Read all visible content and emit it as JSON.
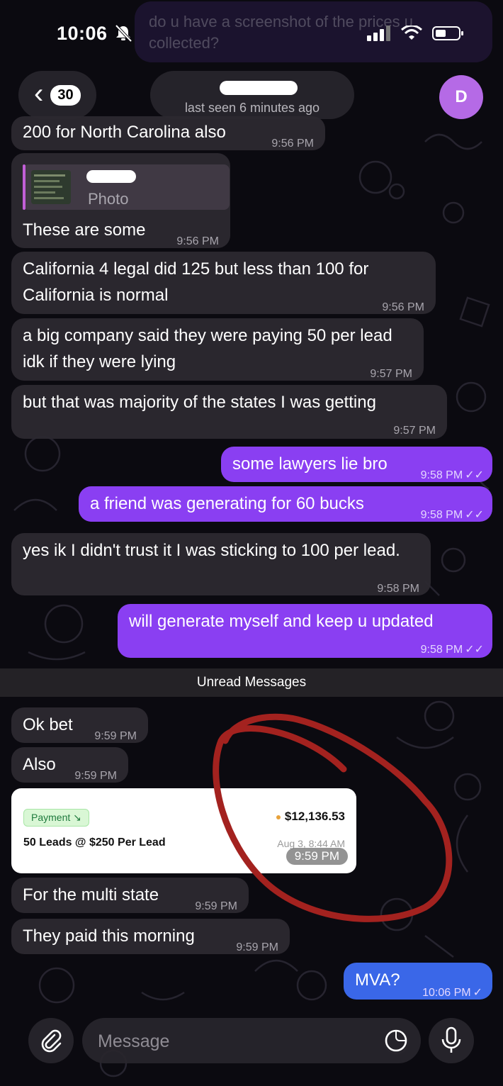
{
  "status_bar": {
    "time": "10:06",
    "top_notification_preview": "do u have a screenshot of the prices u collected?"
  },
  "header": {
    "back_count": "30",
    "last_seen": "last seen 6 minutes ago",
    "avatar_letter": "D"
  },
  "messages": [
    {
      "text": "200 for North Carolina also",
      "time": "9:56 PM"
    },
    {
      "reply_label": "Photo",
      "text": "These are some",
      "time": "9:56 PM"
    },
    {
      "text": "California 4 legal did 125 but less than 100 for California is normal",
      "time": "9:56 PM"
    },
    {
      "text": "a big company said they were paying 50 per lead idk if they were lying",
      "time": "9:57 PM"
    },
    {
      "text": "but that was majority of the states I was getting",
      "time": "9:57 PM"
    },
    {
      "text": "some lawyers lie bro",
      "time": "9:58 PM"
    },
    {
      "text": "a friend was generating for 60 bucks",
      "time": "9:58 PM"
    },
    {
      "text": "yes ik I didn't trust it I was sticking to 100 per lead.",
      "time": "9:58 PM"
    },
    {
      "text": "will generate myself and keep u updated",
      "time": "9:58 PM"
    },
    {
      "text": "Ok bet",
      "time": "9:59 PM"
    },
    {
      "text": "Also",
      "time": "9:59 PM"
    },
    {
      "text": "For the multi state",
      "time": "9:59 PM"
    },
    {
      "text": "They paid this morning",
      "time": "9:59 PM"
    },
    {
      "text": "MVA?",
      "time": "10:06 PM"
    }
  ],
  "unread_label": "Unread Messages",
  "payment_card": {
    "badge": "Payment ↘",
    "description": "50 Leads @ $250 Per Lead",
    "amount": "$12,136.53",
    "date": "Aug 3, 8:44 AM",
    "time": "9:59 PM"
  },
  "composer": {
    "placeholder": "Message"
  },
  "colors": {
    "outgoing": "#8a3ff2",
    "outgoing_last": "#3a67e8",
    "incoming": "#2c2930",
    "annotation_circle": "#a3221f"
  },
  "icons": [
    "bell-slash-icon",
    "signal-icon",
    "wifi-icon",
    "battery-icon",
    "chevron-left-icon",
    "paperclip-icon",
    "sticker-icon",
    "microphone-icon",
    "read-checks-icon"
  ]
}
